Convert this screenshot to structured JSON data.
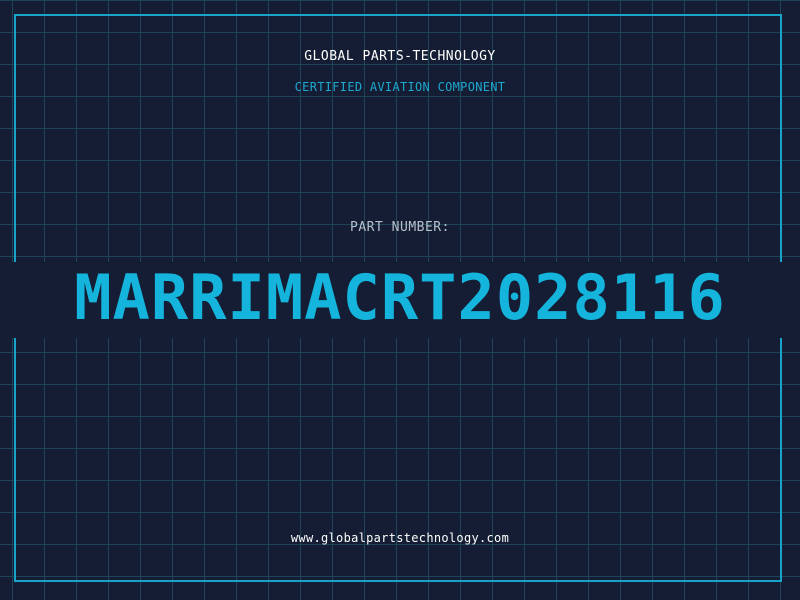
{
  "header": {
    "company": "GLOBAL PARTS-TECHNOLOGY",
    "tagline": "CERTIFIED AVIATION COMPONENT"
  },
  "part": {
    "label": "PART NUMBER:",
    "number": "MARRIMACRT2028116"
  },
  "footer": {
    "website": "www.globalpartstechnology.com"
  },
  "colors": {
    "background": "#141d33",
    "grid": "#1d4459",
    "accent": "#14b4dc",
    "frame": "#1aa3c8",
    "text": "#ffffff",
    "label": "#b8c0cc"
  }
}
